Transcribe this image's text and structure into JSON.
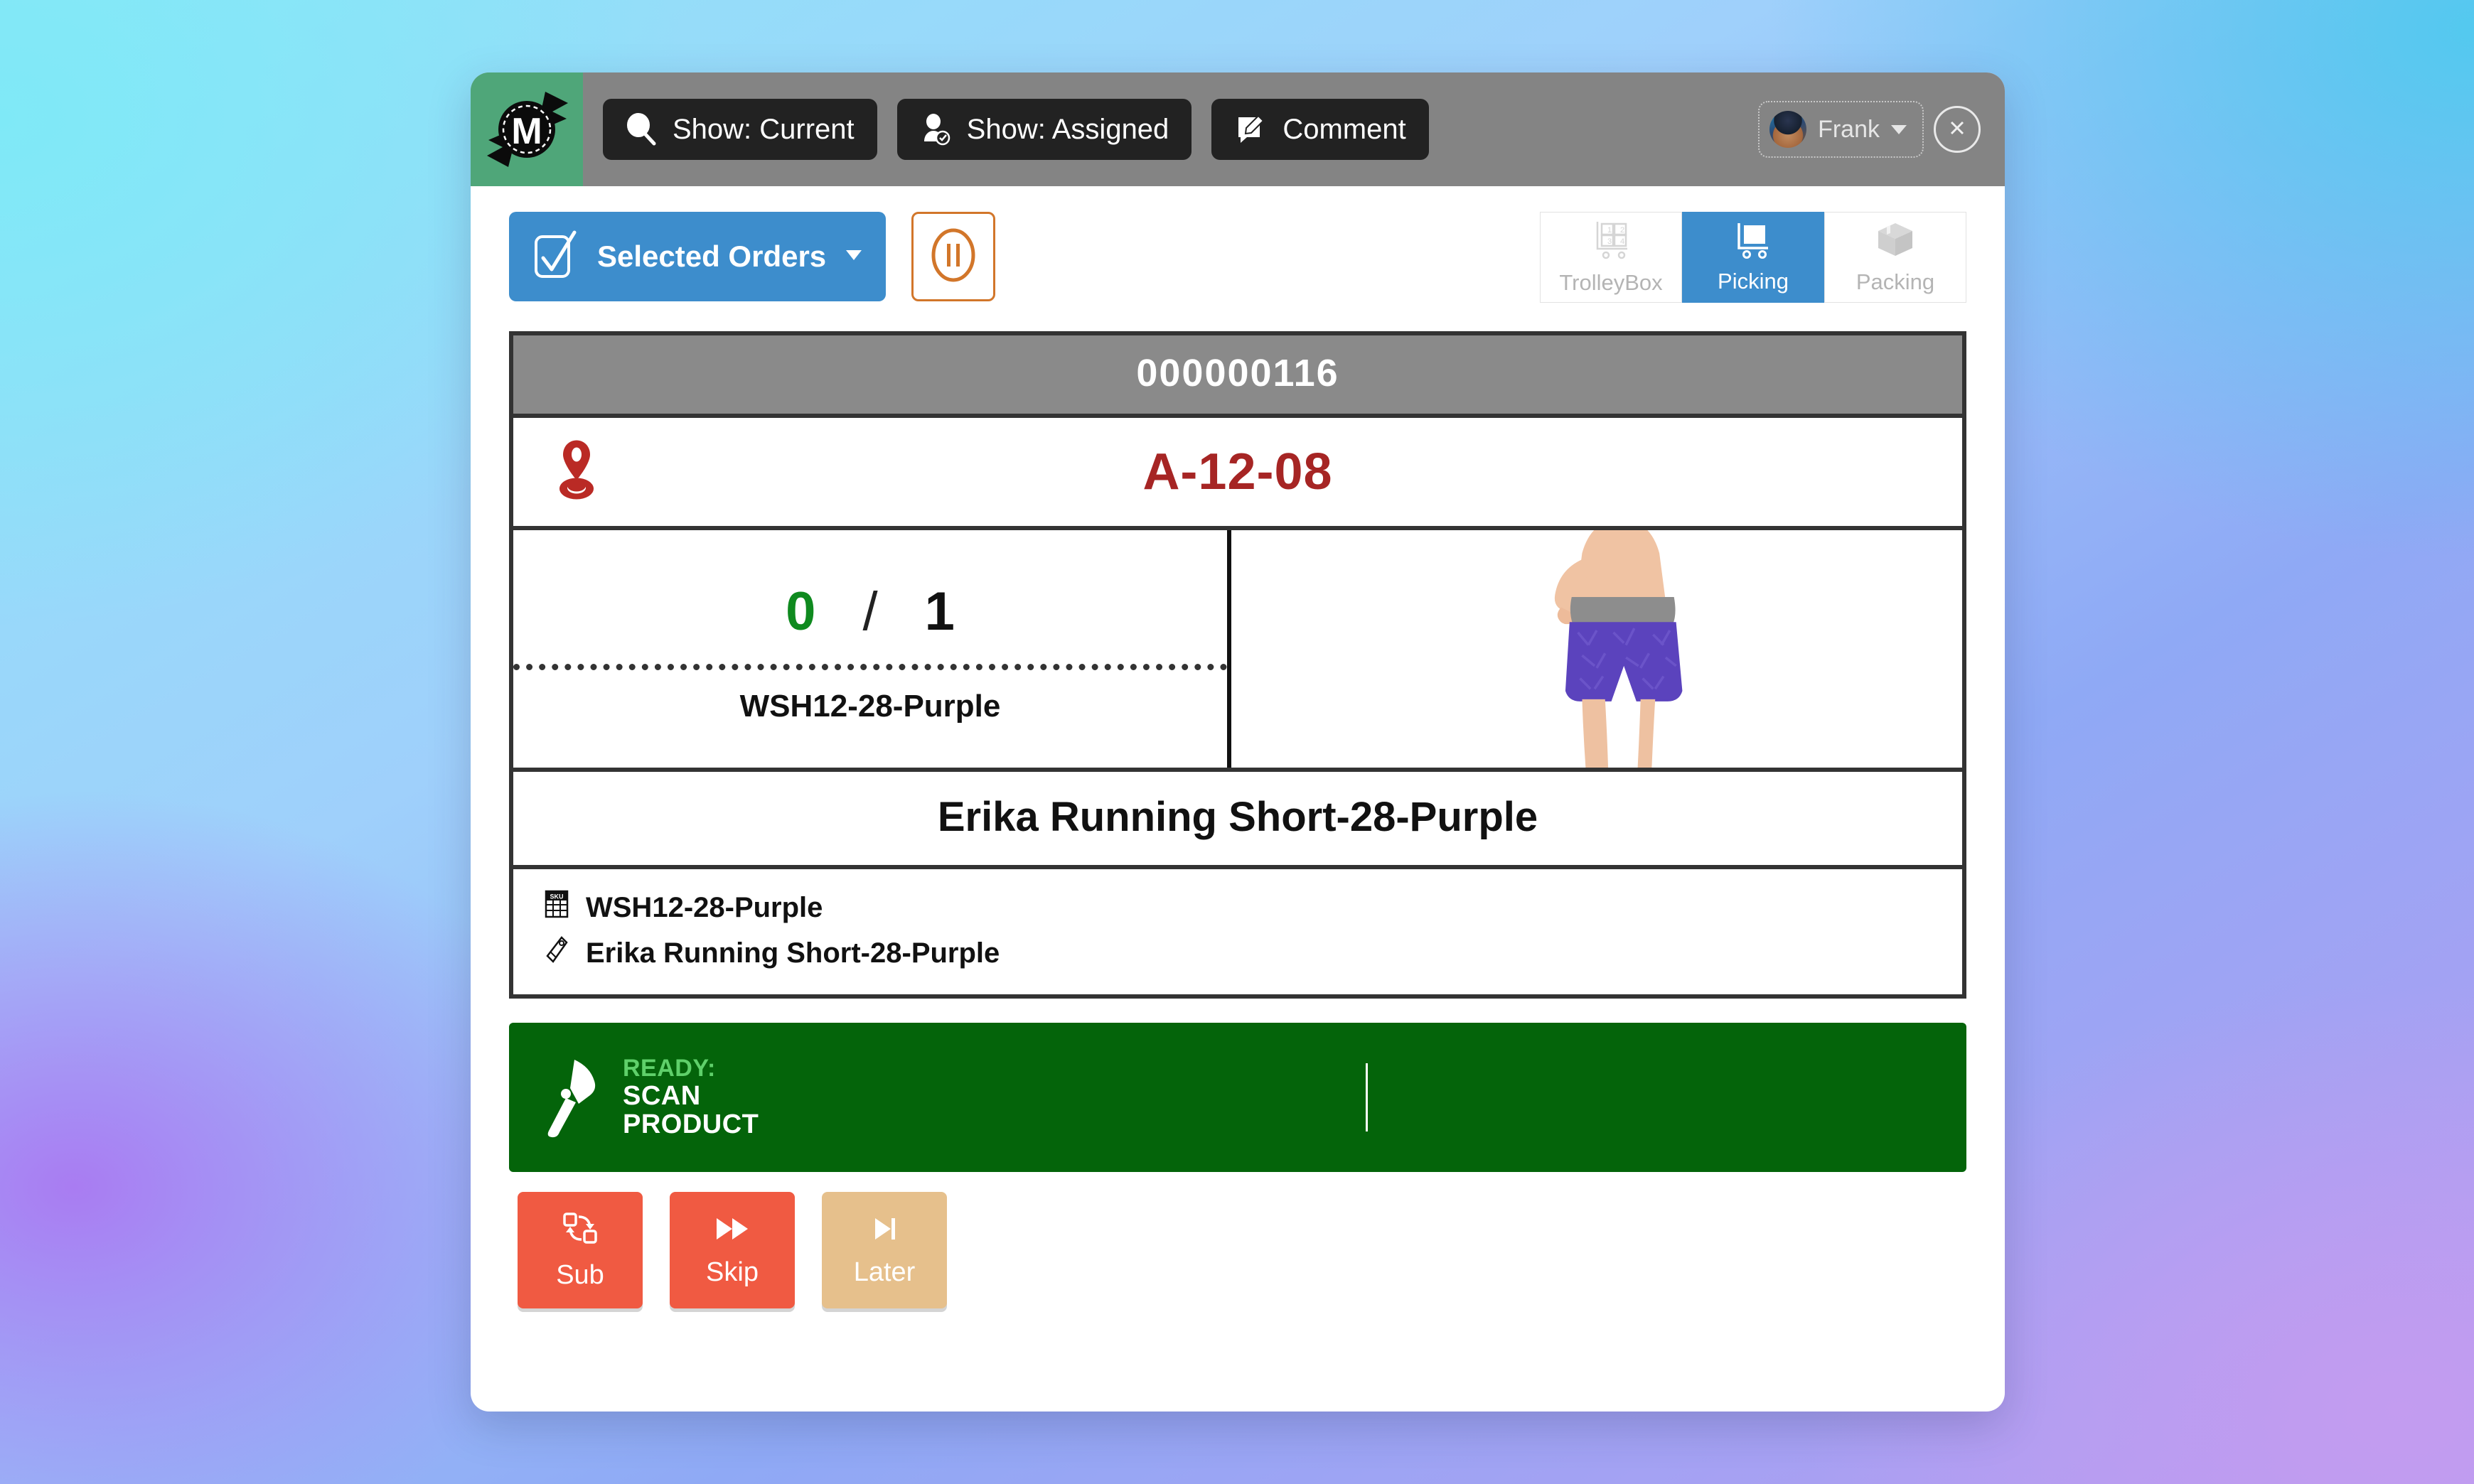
{
  "header": {
    "logo_letter": "M",
    "buttons": [
      {
        "icon": "magnifier-icon",
        "label": "Show: Current"
      },
      {
        "icon": "user-check-icon",
        "label": "Show: Assigned"
      },
      {
        "icon": "comment-pencil-icon",
        "label": "Comment"
      }
    ],
    "user": {
      "name": "Frank",
      "avatar": "user-avatar",
      "caret": "chevron-down-icon"
    },
    "close_label": "close-icon"
  },
  "modebar": {
    "selected_orders_label": "Selected Orders",
    "selected_orders_icon": "checkbox-checked-icon",
    "selected_orders_caret": "chevron-down-icon",
    "pause_icon": "pause-circle-icon",
    "modes": [
      {
        "label": "TrolleyBox",
        "icon": "trolley-grid-icon",
        "active": false
      },
      {
        "label": "Picking",
        "icon": "shopping-cart-icon",
        "active": true
      },
      {
        "label": "Packing",
        "icon": "box-icon",
        "active": false
      }
    ]
  },
  "card": {
    "order_number": "000000116",
    "location": {
      "icon": "map-pin-icon",
      "value": "A-12-08"
    },
    "counts": {
      "done": "0",
      "separator": "/",
      "total": "1"
    },
    "sku_small": "WSH12-28-Purple",
    "product_image_alt": "woman wearing purple running shorts",
    "product_name": "Erika Running Short-28-Purple",
    "details": [
      {
        "icon": "sku-grid-icon",
        "value": "WSH12-28-Purple"
      },
      {
        "icon": "price-tag-icon",
        "value": "Erika Running Short-28-Purple"
      }
    ]
  },
  "scanbar": {
    "icon": "barcode-scanner-icon",
    "ready_label": "READY:",
    "line1": "SCAN",
    "line2": "PRODUCT",
    "input_value": ""
  },
  "actions": [
    {
      "label": "Sub",
      "icon": "swap-icon",
      "style": "red"
    },
    {
      "label": "Skip",
      "icon": "fast-forward-icon",
      "style": "red"
    },
    {
      "label": "Later",
      "icon": "skip-end-icon",
      "style": "tan"
    }
  ],
  "colors": {
    "accent_blue": "#3d8dcc",
    "logo_green": "#4fa679",
    "scan_green": "#04640a",
    "ready_green": "#5fd06a",
    "location_red": "#a62524",
    "count_done_green": "#0f8a1f",
    "action_red": "#f05a42",
    "action_tan": "#e6c08c",
    "pause_orange": "#d2762a",
    "header_grey": "#848484",
    "ordernum_grey": "#8a8a8a"
  }
}
